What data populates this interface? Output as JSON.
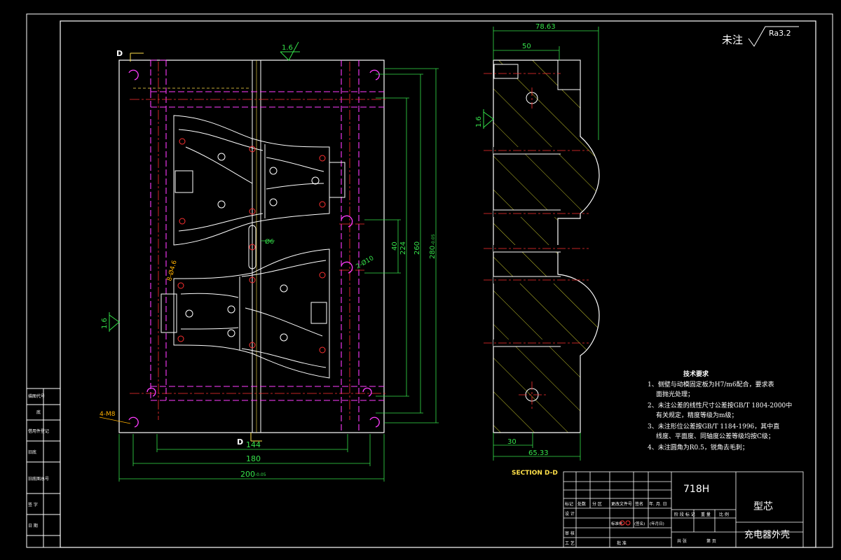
{
  "roughness": {
    "label": "未注",
    "value": "Ra3.2",
    "surface_mark": "1.6"
  },
  "section_marks": {
    "top": "D",
    "bottom": "D",
    "caption": "SECTION D-D"
  },
  "dimensions": {
    "overall_width": "200",
    "overall_width_tol": "-0.05",
    "inner_180": "180",
    "inner_144": "144",
    "h_40": "40",
    "h_224": "224",
    "h_260": "260",
    "h_280": "280",
    "h_280_tol": "-0.05",
    "hole_6": "Ø6",
    "holes_10": "2-Ø10",
    "holes_16": "8-Ø4.6",
    "screws": "4-M8",
    "side_top_total": "78.63",
    "side_top_50": "50",
    "side_bottom_30": "30",
    "side_bottom_total": "65.33"
  },
  "tech_requirements": {
    "title": "技术要求",
    "items": [
      "1、侧壁与动模固定板为H7/m6配合，要求表",
      "面抛光处理；",
      "2、未注公差的线性尺寸公差按GB/T 1804-2000中",
      "有关规定，精度等级为m级；",
      "3、未注形位公差按GB/T 1184-1996，其中直",
      "线度、平面度、同轴度公差等级均按C级；",
      "4、未注圆角为R0.5，锐角去毛刺；"
    ]
  },
  "left_strip": [
    "描图代号",
    "底",
    "借用件登记",
    "旧底",
    "签名",
    "旧底图总号",
    "签 字",
    "日 期"
  ],
  "title_block": {
    "material": "718H",
    "part_name": "型芯",
    "product": "充电器外壳",
    "header_cells": [
      "标记",
      "处数",
      "分 区",
      "更改文件号",
      "签名",
      "年. 月. 日"
    ],
    "rows": [
      "设 计",
      "审 核",
      "工 艺"
    ],
    "mid_cells": [
      "标准化",
      "(签名)",
      "(年月日)",
      "批 准"
    ],
    "stage_cells": [
      "阶 段 标 记",
      "重 量",
      "比 例"
    ],
    "bottom_cells": [
      "共 张",
      "第 页"
    ]
  }
}
